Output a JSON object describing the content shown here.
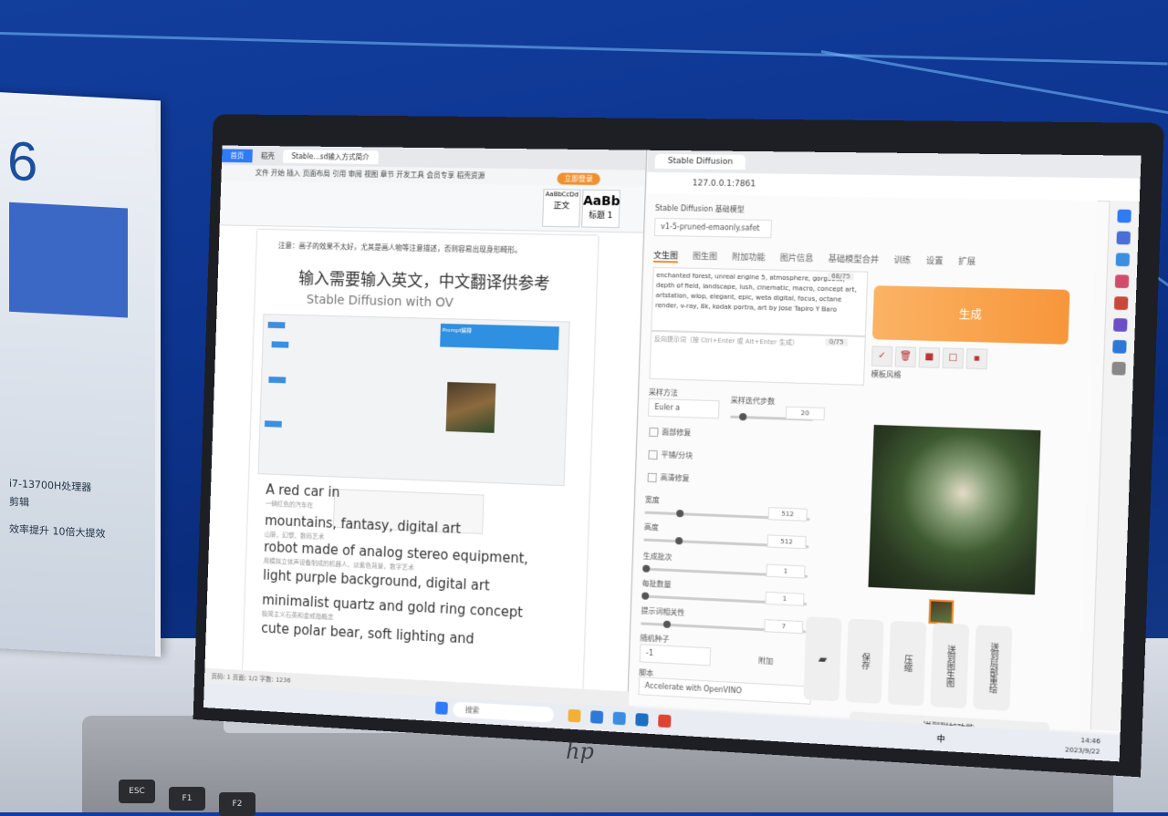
{
  "colors": {
    "accent_orange": "#f7963b",
    "doc_home_blue": "#2f7af5",
    "wall_blue": "#0d3590"
  },
  "stand": {
    "number": "6",
    "lines": [
      "i7-13700H处理器",
      "剪辑",
      "效率提升 10倍大提效"
    ]
  },
  "laptop": {
    "logo": "hp",
    "keys": [
      "ESC",
      "F1",
      "F2"
    ]
  },
  "doc": {
    "tabs": [
      "首页",
      "稻壳",
      "Stable…sd输入方式简介"
    ],
    "menu": "文件  开始  插入  页面布局  引用  审阅  视图  章节  开发工具  会员专享  稻壳资源",
    "login": "立即登录",
    "styles": [
      {
        "sample": "AaBbCcDd",
        "name": "正文"
      },
      {
        "sample": "AaBb",
        "name": "标题 1"
      }
    ],
    "intro": "注意：画子的效果不太好，尤其是画人物等注意描述，否则容易出现身形畸形。",
    "heading": "输入需要输入英文，中文翻译供参考",
    "subheading": "Stable Diffusion with OV",
    "embed_note": "Prompt解释",
    "paragraphs": [
      "A red car in",
      "mountains, fantasy, digital art",
      "robot made of analog stereo equipment,",
      "light purple background, digital art",
      "minimalist quartz and gold ring concept",
      "cute polar bear, soft lighting and"
    ],
    "small_notes": [
      "一辆红色的汽车在",
      "山脉，幻想，数码艺术",
      "用模拟立体声设备制成的机器人，淡紫色背景，数字艺术",
      "极简主义石英和金戒指概念"
    ],
    "status": "页码: 1  页面: 1/2  字数: 1236"
  },
  "browser": {
    "tab_title": "Stable Diffusion",
    "url": "127.0.0.1:7861",
    "model_label": "Stable Diffusion 基础模型",
    "model_value": "v1-5-pruned-emaonly.safet",
    "tabs": [
      "文生图",
      "图生图",
      "附加功能",
      "图片信息",
      "基础模型合并",
      "训练",
      "设置",
      "扩展"
    ],
    "prompt": "enchanted forest, unreal engine 5, atmosphere, gorgeous, depth of field, landscape, lush, cinematic, macro, concept art, artstation, wlop, elegant, epic, weta digital, focus, octane render, v-ray, 8k, kodak portra, art by Jose Tapiro Y Baro",
    "prompt_count": "68/75",
    "negative_placeholder": "反向提示词（按 Ctrl+Enter 或 Alt+Enter 生成）",
    "negative_count": "0/75",
    "generate": "生成",
    "template_style": "模板风格",
    "sampler_label": "采样方法",
    "sampler_value": "Euler a",
    "steps_label": "采样迭代步数",
    "steps": "20",
    "checks": [
      "面部修复",
      "平铺/分块",
      "高清修复"
    ],
    "width_label": "宽度",
    "width": "512",
    "height_label": "高度",
    "height": "512",
    "batch_count_label": "生成批次",
    "batch_count": "1",
    "batch_size_label": "每批数量",
    "batch_size": "1",
    "cfg_label": "提示词相关性",
    "cfg": "7",
    "seed_label": "随机种子",
    "seed": "-1",
    "extra": "附加",
    "script_label": "脚本",
    "script_value": "Accelerate with OpenVINO",
    "action_buttons": [
      "保存",
      "压缩",
      "送到图生图",
      "送到局部重绘"
    ],
    "send_extras": "送到附加功能"
  },
  "taskbar": {
    "search": "搜索",
    "ime": "中",
    "time": "14:46",
    "date": "2023/9/22"
  }
}
